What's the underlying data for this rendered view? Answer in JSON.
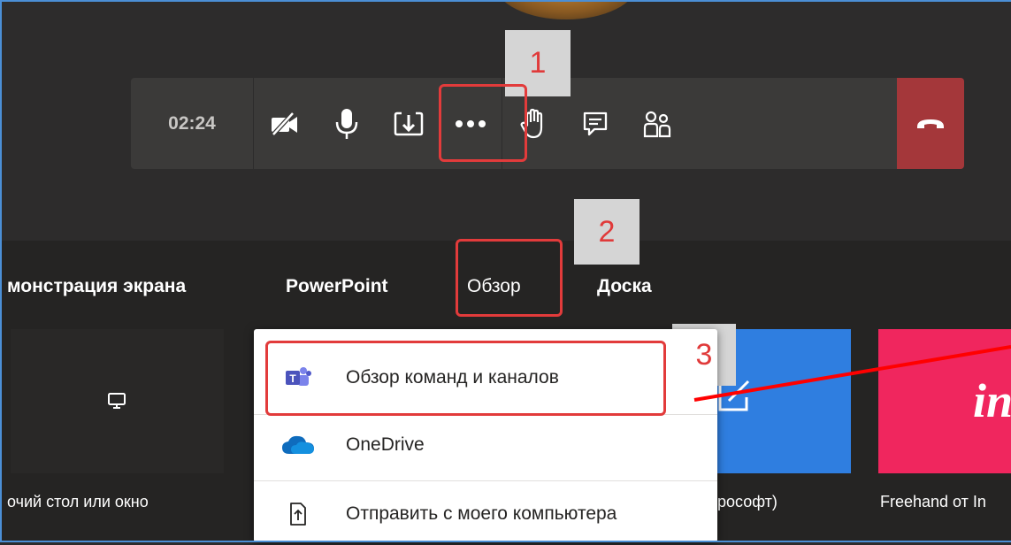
{
  "toolbar": {
    "time": "02:24",
    "buttons": [
      {
        "name": "camera-off-icon"
      },
      {
        "name": "microphone-icon"
      },
      {
        "name": "share-tray-icon"
      },
      {
        "name": "more-icon"
      },
      {
        "name": "raise-hand-icon"
      },
      {
        "name": "chat-icon"
      },
      {
        "name": "participants-icon"
      },
      {
        "name": "hang-up-icon"
      }
    ]
  },
  "callouts": {
    "one": "1",
    "two": "2",
    "three": "3"
  },
  "share_tabs": {
    "screen": "монстрация экрана",
    "powerpoint": "PowerPoint",
    "browse": "Обзор",
    "whiteboard": "Доска"
  },
  "tiles": {
    "desktop_caption": "очий стол или окно",
    "whiteboard_caption": "рософт)",
    "freehand_caption": "Freehand от In",
    "freehand_logo": "in"
  },
  "dropdown": {
    "items": [
      {
        "label": "Обзор команд и каналов",
        "icon": "teams-icon"
      },
      {
        "label": "OneDrive",
        "icon": "onedrive-icon"
      },
      {
        "label": "Отправить с моего компьютера",
        "icon": "upload-file-icon"
      }
    ]
  },
  "colors": {
    "background": "#2d2c2c",
    "toolbar": "#3b3a39",
    "hangup": "#a4373a",
    "highlight": "#e23b3b",
    "whiteboard_tile": "#2f7ee0",
    "freehand_tile": "#f0265e"
  }
}
